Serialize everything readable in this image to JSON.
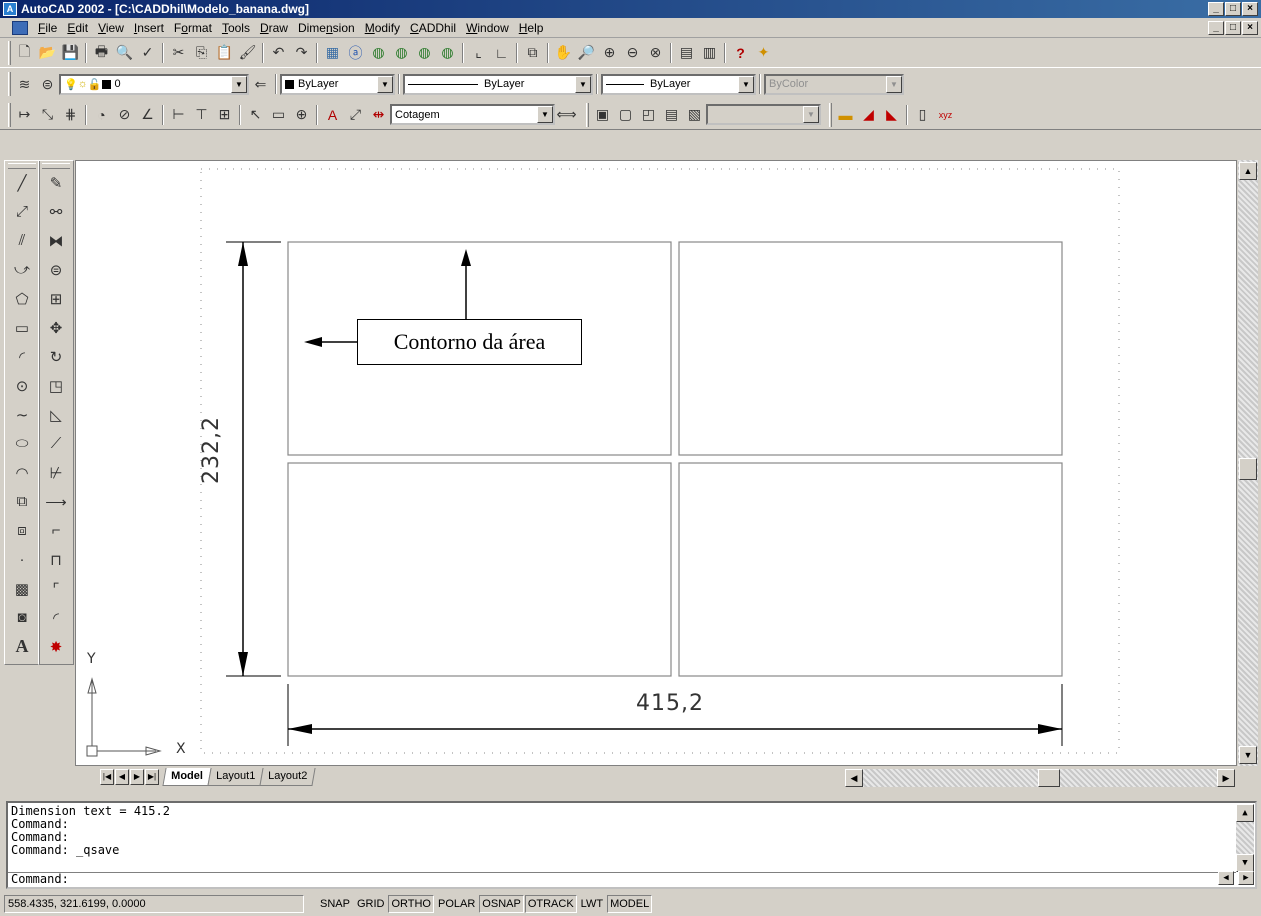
{
  "window": {
    "title": "AutoCAD 2002 - [C:\\CADDhil\\Modelo_banana.dwg]",
    "controls": [
      "_",
      "□",
      "×"
    ]
  },
  "menu": [
    {
      "first": "F",
      "rest": "ile"
    },
    {
      "first": "E",
      "rest": "dit"
    },
    {
      "first": "V",
      "rest": "iew"
    },
    {
      "first": "I",
      "rest": "nsert"
    },
    {
      "pre": "F",
      "first": "o",
      "rest": "rmat"
    },
    {
      "first": "T",
      "rest": "ools"
    },
    {
      "first": "D",
      "rest": "raw"
    },
    {
      "pre": "Dime",
      "first": "n",
      "rest": "sion"
    },
    {
      "first": "M",
      "rest": "odify"
    },
    {
      "first": "C",
      "rest": "ADDhil"
    },
    {
      "first": "W",
      "rest": "indow"
    },
    {
      "first": "H",
      "rest": "elp"
    }
  ],
  "properties_toolbar": {
    "layer": "0",
    "color": "ByLayer",
    "linetype": "ByLayer",
    "lineweight": "ByLayer",
    "plotstyle": "ByColor"
  },
  "dimension_toolbar": {
    "dimstyle": "Cotagem"
  },
  "drawing": {
    "label": "Contorno da área",
    "dim_horizontal": "415,2",
    "dim_vertical": "232,2",
    "axis_x": "X",
    "axis_y": "Y"
  },
  "tabs": [
    "Model",
    "Layout1",
    "Layout2"
  ],
  "command_history": [
    "Dimension text = 415.2",
    "Command:",
    "Command:",
    "Command: _qsave"
  ],
  "command_prompt": "Command:",
  "status": {
    "coords": "558.4335, 321.6199, 0.0000",
    "toggles": [
      {
        "label": "SNAP",
        "on": false
      },
      {
        "label": "GRID",
        "on": false
      },
      {
        "label": "ORTHO",
        "on": true
      },
      {
        "label": "POLAR",
        "on": false
      },
      {
        "label": "OSNAP",
        "on": true
      },
      {
        "label": "OTRACK",
        "on": true
      },
      {
        "label": "LWT",
        "on": false
      },
      {
        "label": "MODEL",
        "on": true
      }
    ]
  }
}
